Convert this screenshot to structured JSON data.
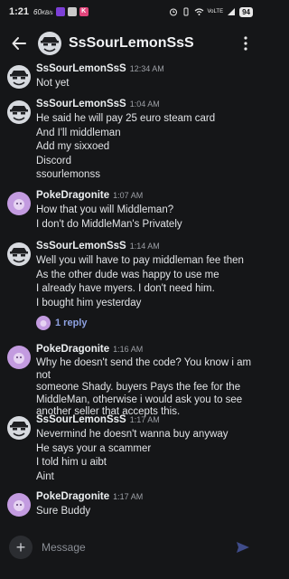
{
  "status_bar": {
    "time": "1:21",
    "speed": "60KB/s",
    "network": "VoLTE",
    "battery": "94"
  },
  "header": {
    "title": "SsSourLemonSsS"
  },
  "composer": {
    "placeholder": "Message"
  },
  "messages": [
    {
      "author": "SsSourLemonSsS",
      "time": "12:34 AM",
      "lines": [
        "Not yet"
      ]
    },
    {
      "author": "SsSourLemonSsS",
      "time": "1:04 AM",
      "lines": [
        "He said he will pay 25 euro steam card",
        "And I'll middleman",
        "Add my sixxoed",
        "Discord",
        "ssourlemonss"
      ]
    },
    {
      "author": "PokeDragonite",
      "time": "1:07 AM",
      "lines": [
        "How that you will Middleman?",
        "I don't do MiddleMan's Privately"
      ]
    },
    {
      "author": "SsSourLemonSsS",
      "time": "1:14 AM",
      "lines": [
        "Well you will have to pay middleman fee then",
        "As the other dude was happy to use me",
        "I already have myers. I don't need him.",
        "I bought him yesterday"
      ],
      "reply_label": "1 reply"
    },
    {
      "author": "PokeDragonite",
      "time": "1:16 AM",
      "lines": [
        "Why he doesn't send the code? You know i am not",
        "someone Shady. buyers Pays the fee for the",
        "MiddleMan, otherwise i would ask you to see",
        "another seller that accepts this."
      ]
    },
    {
      "author": "SsSourLemonSsS",
      "time": "1:17 AM",
      "lines": [
        "Nevermind he doesn't wanna buy anyway",
        "He says your a scammer",
        "I told him u aibt",
        "Aint"
      ]
    },
    {
      "author": "PokeDragonite",
      "time": "1:17 AM",
      "lines": [
        "Sure Buddy"
      ]
    }
  ],
  "colors": {
    "background": "#151618",
    "text": "#e1e3e6",
    "timestamp": "#9da0a6",
    "link": "#8ea1e1",
    "send": "#5865f2",
    "dragonite_avatar": "#c39be0"
  }
}
